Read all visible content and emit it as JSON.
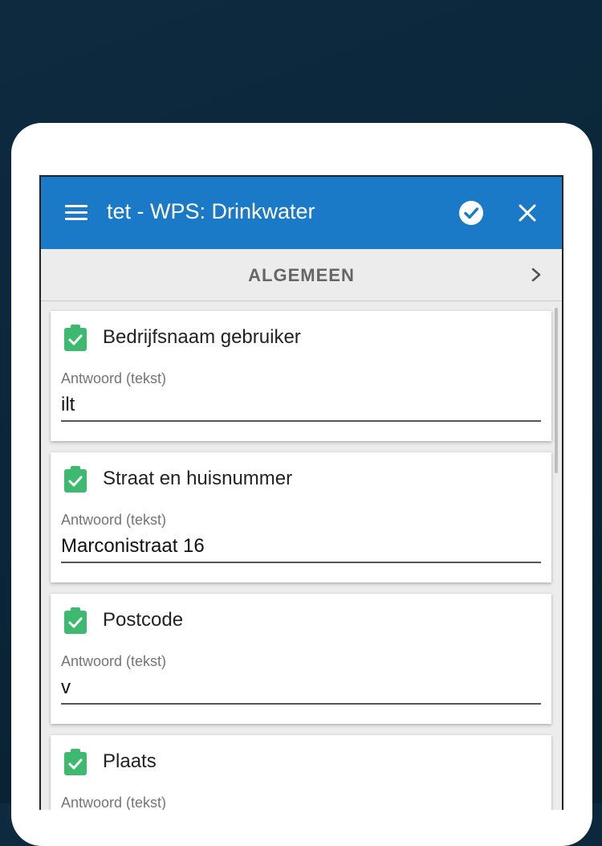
{
  "appbar": {
    "title": "tet - WPS: Drinkwater",
    "menu_icon": "hamburger-menu-icon",
    "confirm_icon": "check-circle-icon",
    "close_icon": "close-icon",
    "color": "#1a7ac8"
  },
  "section": {
    "title": "ALGEMEEN",
    "next_icon": "chevron-right-icon"
  },
  "questions": [
    {
      "label": "Bedrijfsnaam gebruiker",
      "answer_label": "Antwoord (tekst)",
      "value": "ilt"
    },
    {
      "label": "Straat en huisnummer",
      "answer_label": "Antwoord (tekst)",
      "value": "Marconistraat 16"
    },
    {
      "label": "Postcode",
      "answer_label": "Antwoord (tekst)",
      "value": "v"
    },
    {
      "label": "Plaats",
      "answer_label": "Antwoord (tekst)",
      "value": ""
    }
  ],
  "colors": {
    "check_green": "#3dba6f",
    "background": "#0a2537"
  }
}
